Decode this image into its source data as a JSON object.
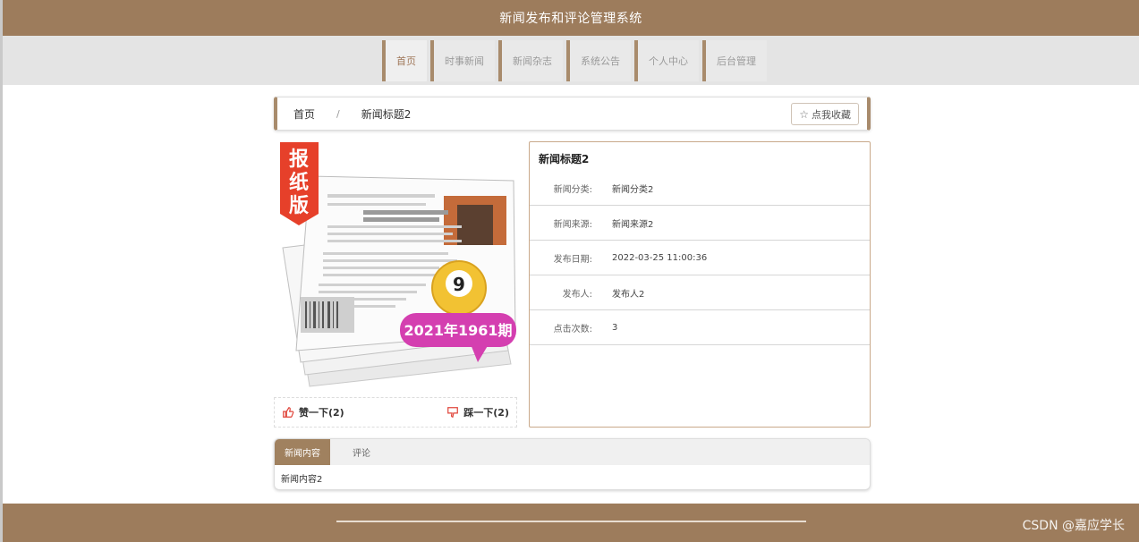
{
  "header": {
    "title": "新闻发布和评论管理系统"
  },
  "nav": {
    "items": [
      {
        "label": "首页",
        "active": true
      },
      {
        "label": "时事新闻",
        "active": false
      },
      {
        "label": "新闻杂志",
        "active": false
      },
      {
        "label": "系统公告",
        "active": false
      },
      {
        "label": "个人中心",
        "active": false
      },
      {
        "label": "后台管理",
        "active": false
      }
    ]
  },
  "breadcrumb": {
    "home": "首页",
    "separator": "/",
    "current": "新闻标题2"
  },
  "favorite_button": {
    "label": "点我收藏",
    "icon": "star-icon"
  },
  "image": {
    "badge_text": "报纸版",
    "issue_number": "9",
    "issue_text": "2021年1961期"
  },
  "votes": {
    "like_label": "赞一下(2)",
    "dislike_label": "踩一下(2)"
  },
  "detail": {
    "title": "新闻标题2",
    "fields": [
      {
        "key": "新闻分类:",
        "value": "新闻分类2"
      },
      {
        "key": "新闻来源:",
        "value": "新闻来源2"
      },
      {
        "key": "发布日期:",
        "value": "2022-03-25 11:00:36"
      },
      {
        "key": "发布人:",
        "value": "发布人2"
      },
      {
        "key": "点击次数:",
        "value": "3"
      }
    ]
  },
  "tabs": {
    "items": [
      {
        "label": "新闻内容",
        "active": true
      },
      {
        "label": "评论",
        "active": false
      }
    ],
    "content": "新闻内容2"
  },
  "watermark": "CSDN @嘉应学长",
  "colors": {
    "brand": "#9d7c5c",
    "accent": "#a88b6c",
    "like": "#e0463b",
    "badge_red": "#e6402a",
    "issue_purple": "#d43fb0"
  }
}
